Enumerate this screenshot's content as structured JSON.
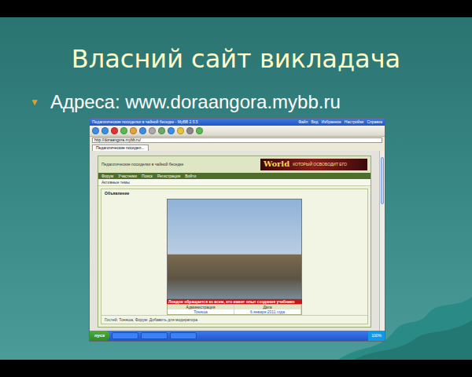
{
  "slide": {
    "title": "Власний сайт викладача",
    "bullets": [
      {
        "marker": "▼",
        "text": "Адреса: www.doraangora.mybb.ru"
      }
    ]
  },
  "browser": {
    "window_title": "Педагогические посиделки в чайной беседке - MyBB 2.5.5",
    "menu": [
      "Файл",
      "Вид",
      "Избранное",
      "Настройки",
      "Справка"
    ],
    "address": "http://doraangora.mybb.ru/",
    "tabs": [
      {
        "label": "Педагогические посидел...",
        "selected": true
      }
    ],
    "forum": {
      "title": "Педагогические посиделки в чайной беседке",
      "banner": "World",
      "banner_text": "КОТОРЫЙ ОСВОБОДИТ ЕГО",
      "nav": [
        "Форум",
        "Участники",
        "Поиск",
        "Регистрация",
        "Войти"
      ],
      "sub": "Активные темы",
      "section": "Объявление",
      "caption": "Лондон обращается ко всем, кто имеет опыт создания учебнико",
      "table": [
        [
          "Администрация",
          "Дата"
        ],
        [
          "Тоняша",
          "6 января 2011 года"
        ]
      ],
      "footer": "Гостей: Тоняша, Форум: Добавить для модератора"
    },
    "taskbar": {
      "start": "пуск",
      "clock": "100%"
    }
  }
}
